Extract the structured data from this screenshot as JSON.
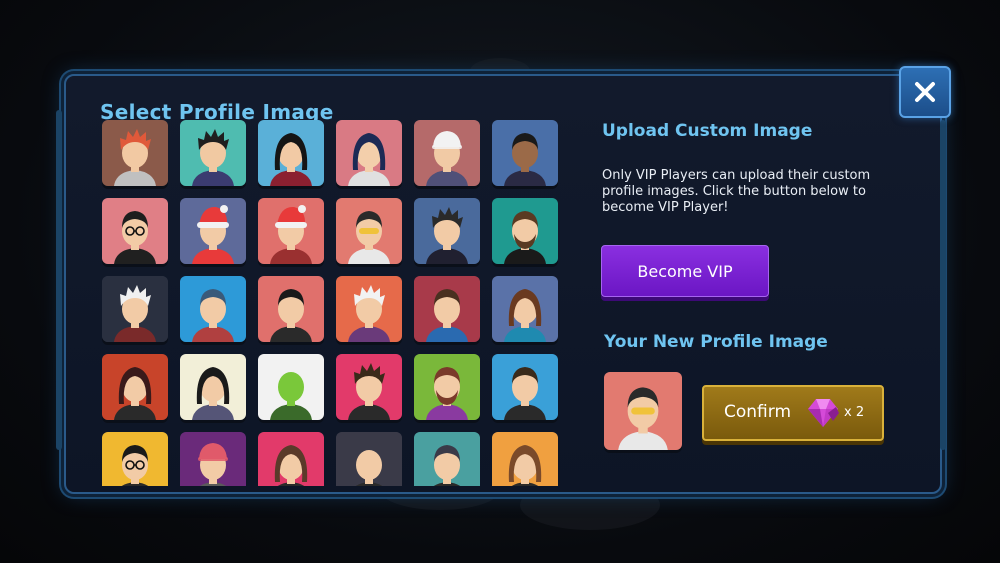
{
  "dialog": {
    "left_title": "Select Profile Image",
    "upload_title": "Upload Custom Image",
    "description": "Only VIP Players can upload their custom profile images. Click the button below to become VIP Player!",
    "vip_button_label": "Become VIP",
    "new_image_title": "Your New Profile Image",
    "confirm_label": "Confirm",
    "cost_count": "x 2",
    "close_icon": "close-icon",
    "cost_icon": "gem-icon"
  },
  "colors": {
    "title": "#6fc4f0",
    "vip": "#7a22d6",
    "confirm": "#8c6a12"
  },
  "avatars": [
    {
      "bg": "#7b4f8f",
      "skin": "#f0c8a2",
      "hair": "#c94d3a",
      "shirt": "#3a3a66",
      "style": "short"
    },
    {
      "bg": "#c9533f",
      "skin": "#f2cda8",
      "hair": "#e8e8e8",
      "shirt": "#8a3030",
      "style": "bald"
    },
    {
      "bg": "#6b4a7e",
      "skin": "#f0c6a0",
      "hair": "#3a2a2a",
      "shirt": "#3e3e5a",
      "style": "short"
    },
    {
      "bg": "#e89a86",
      "skin": "#f3d0ad",
      "hair": "#5a3a2a",
      "shirt": "#a04040",
      "style": "short"
    },
    {
      "bg": "#c8263a",
      "skin": "#f0c6a0",
      "hair": "#2a2a3a",
      "shirt": "#4a4a6a",
      "style": "cap"
    },
    {
      "bg": "#5a4a8a",
      "skin": "#f1caa4",
      "hair": "#e0e0e0",
      "shirt": "#6a6a8a",
      "style": "bald"
    },
    {
      "bg": "#8b5a4a",
      "skin": "#f2c9a3",
      "hair": "#e0593a",
      "shirt": "#c0c0c0",
      "style": "spiky"
    },
    {
      "bg": "#4fbcb0",
      "skin": "#f1c9a2",
      "hair": "#1f1f1f",
      "shirt": "#3b3b70",
      "style": "spiky"
    },
    {
      "bg": "#5ab0d8",
      "skin": "#f2caa5",
      "hair": "#151515",
      "shirt": "#8b2030",
      "style": "long"
    },
    {
      "bg": "#d97a84",
      "skin": "#f3cfab",
      "hair": "#1c2a55",
      "shirt": "#e0e0e0",
      "style": "long"
    },
    {
      "bg": "#b56a6a",
      "skin": "#f1caa5",
      "hair": "#f2f2f2",
      "shirt": "#505078",
      "style": "cap"
    },
    {
      "bg": "#4a6fa8",
      "skin": "#9b6a48",
      "hair": "#1a1a1a",
      "shirt": "#2a2a44",
      "style": "short"
    },
    {
      "bg": "#e07f86",
      "skin": "#f2cba6",
      "hair": "#1e1e1e",
      "shirt": "#202020",
      "style": "glasses"
    },
    {
      "bg": "#5e6a9a",
      "skin": "#f2cba6",
      "hair": "#e83a3a",
      "shirt": "#e83a3a",
      "style": "santa"
    },
    {
      "bg": "#e0706c",
      "skin": "#f2cba6",
      "hair": "#e83a3a",
      "shirt": "#9a3030",
      "style": "santa"
    },
    {
      "bg": "#e27a70",
      "skin": "#f2cba6",
      "hair": "#2a2a2a",
      "shirt": "#e8e8e8",
      "style": "shades"
    },
    {
      "bg": "#4a6a9c",
      "skin": "#f2cba6",
      "hair": "#2a2a2a",
      "shirt": "#202030",
      "style": "spiky"
    },
    {
      "bg": "#1f9a90",
      "skin": "#f2cba6",
      "hair": "#5a3a22",
      "shirt": "#1a1a1a",
      "style": "beard"
    },
    {
      "bg": "#2a3040",
      "skin": "#f2cba6",
      "hair": "#f0f0f0",
      "shirt": "#7a2a2a",
      "style": "spiky"
    },
    {
      "bg": "#2d9ad8",
      "skin": "#f2cba6",
      "hair": "#3a5a7a",
      "shirt": "#b04040",
      "style": "short"
    },
    {
      "bg": "#e0706c",
      "skin": "#f2cba6",
      "hair": "#1a1a1a",
      "shirt": "#2a2a2a",
      "style": "short"
    },
    {
      "bg": "#e66a4a",
      "skin": "#f2cba6",
      "hair": "#f2f2f2",
      "shirt": "#6a3a7a",
      "style": "spiky"
    },
    {
      "bg": "#a83a4a",
      "skin": "#f2cba6",
      "hair": "#4a3020",
      "shirt": "#2a6ab0",
      "style": "short"
    },
    {
      "bg": "#5a72a8",
      "skin": "#f2cba6",
      "hair": "#6a3a20",
      "shirt": "#1f8ab0",
      "style": "long"
    },
    {
      "bg": "#c8442a",
      "skin": "#f2cba6",
      "hair": "#3a1a1a",
      "shirt": "#2a2a2a",
      "style": "long"
    },
    {
      "bg": "#f2efd8",
      "skin": "#f2cba6",
      "hair": "#1a1a1a",
      "shirt": "#555577",
      "style": "long"
    },
    {
      "bg": "#f2f2f2",
      "skin": "#7ac83a",
      "hair": "#5a9a2a",
      "shirt": "#3a6a2a",
      "style": "bald"
    },
    {
      "bg": "#e23a6a",
      "skin": "#f2cba6",
      "hair": "#3a2a1a",
      "shirt": "#2a2a2a",
      "style": "spiky"
    },
    {
      "bg": "#7ab83a",
      "skin": "#f2cba6",
      "hair": "#7a3a2a",
      "shirt": "#8a3aa0",
      "style": "beard"
    },
    {
      "bg": "#3aa0d8",
      "skin": "#f2cba6",
      "hair": "#3a2a1a",
      "shirt": "#2a2a2a",
      "style": "short"
    },
    {
      "bg": "#f0b830",
      "skin": "#f2cba6",
      "hair": "#1a1a1a",
      "shirt": "#2a2a2a",
      "style": "glasses"
    },
    {
      "bg": "#6a2a7a",
      "skin": "#f2cba6",
      "hair": "#e05a6a",
      "shirt": "#5a5a5a",
      "style": "cap"
    },
    {
      "bg": "#e23a6a",
      "skin": "#f2cba6",
      "hair": "#5a3a2a",
      "shirt": "#2a2a2a",
      "style": "long"
    },
    {
      "bg": "#3a3a48",
      "skin": "#f2cba6",
      "hair": "#f2cba6",
      "shirt": "#2a2a2a",
      "style": "bald"
    },
    {
      "bg": "#4aa0a0",
      "skin": "#f2cba6",
      "hair": "#3a3a48",
      "shirt": "#2a2a2a",
      "style": "short"
    },
    {
      "bg": "#f0a040",
      "skin": "#f2cba6",
      "hair": "#7a4a2a",
      "shirt": "#2a2a2a",
      "style": "long"
    }
  ],
  "preview": {
    "bg": "#e27a70",
    "skin": "#f2cba6",
    "hair": "#2a2a2a",
    "shirt": "#e8e8e8",
    "style": "shades"
  }
}
